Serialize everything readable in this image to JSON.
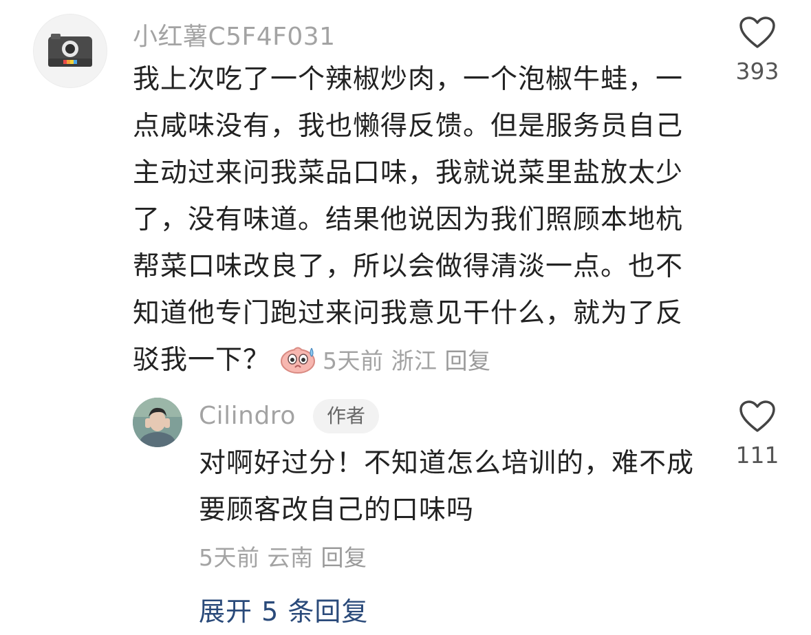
{
  "main_comment": {
    "username": "小红薯C5F4F031",
    "text": "我上次吃了一个辣椒炒肉，一个泡椒牛蛙，一点咸味没有，我也懒得反馈。但是服务员自己主动过来问我菜品口味，我就说菜里盐放太少了，没有味道。结果他说因为我们照顾本地杭帮菜口味改良了，所以会做得清淡一点。也不知道他专门跑过来问我意见干什么，就为了反驳我一下？",
    "emoji": "sweat-face-emoji",
    "time": "5天前",
    "location": "浙江",
    "reply_label": "回复",
    "likes": "393",
    "avatar_icon": "camera-icon"
  },
  "reply_comment": {
    "username": "Cilindro",
    "author_tag": "作者",
    "text": "对啊好过分！不知道怎么培训的，难不成要顾客改自己的口味吗",
    "time": "5天前",
    "location": "云南",
    "reply_label": "回复",
    "likes": "111"
  },
  "expand": {
    "label": "展开 5 条回复"
  },
  "colors": {
    "text": "#222222",
    "secondary": "#a3a3a3",
    "link": "#2a4a7a",
    "tag_bg": "#f2f2f2"
  }
}
